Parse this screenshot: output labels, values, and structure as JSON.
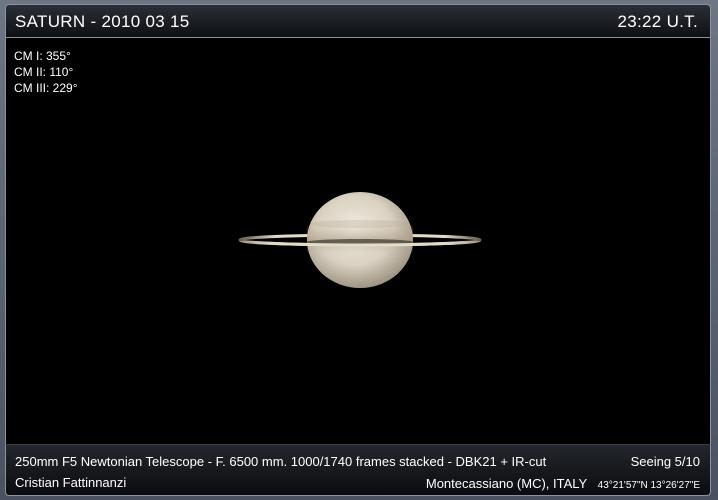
{
  "header": {
    "title": "SATURN - 2010 03 15",
    "time": "23:22  U.T."
  },
  "central_meridians": [
    "CM I: 355°",
    "CM II: 110°",
    "CM III: 229°"
  ],
  "footer": {
    "equipment": "250mm F5 Newtonian Telescope - F. 6500 mm. 1000/1740 frames stacked - DBK21 + IR-cut",
    "seeing": "Seeing 5/10",
    "author": "Cristian Fattinnanzi",
    "location": "Montecassiano (MC), ITALY",
    "coordinates": "43°21'57\"N 13°26'27\"E"
  },
  "colors": {
    "background": "#000000",
    "planet_light": "#e8e2d4",
    "planet_band": "#b9ac98",
    "ring": "#d8d0bc"
  }
}
